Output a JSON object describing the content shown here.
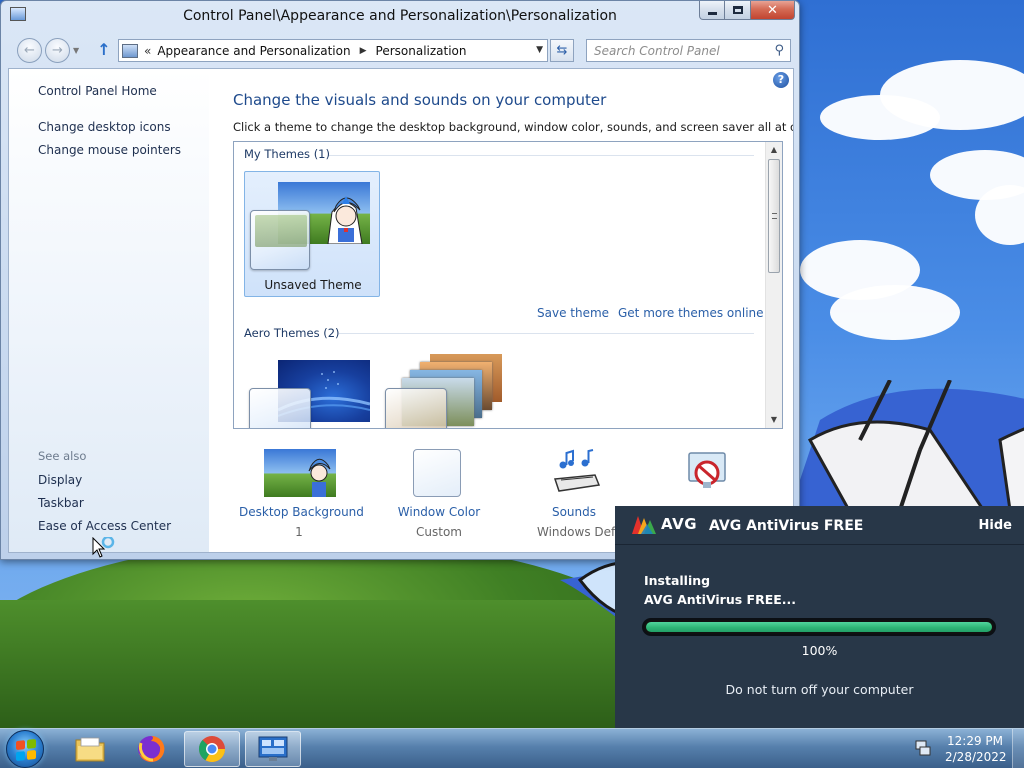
{
  "window": {
    "title": "Control Panel\\Appearance and Personalization\\Personalization",
    "breadcrumb_root": "«",
    "breadcrumb": [
      "Appearance and Personalization",
      "Personalization"
    ],
    "search_placeholder": "Search Control Panel"
  },
  "sidebar": {
    "home": "Control Panel Home",
    "tasks": [
      "Change desktop icons",
      "Change mouse pointers"
    ],
    "see_also_heading": "See also",
    "see_also": [
      "Display",
      "Taskbar",
      "Ease of Access Center"
    ]
  },
  "main": {
    "heading": "Change the visuals and sounds on your computer",
    "description": "Click a theme to change the desktop background, window color, sounds, and screen saver all at once.",
    "my_themes_header": "My Themes (1)",
    "unsaved_theme_label": "Unsaved Theme",
    "save_theme_link": "Save theme",
    "get_more_link": "Get more themes online",
    "aero_themes_header": "Aero Themes (2)"
  },
  "bottom": {
    "items": [
      {
        "label": "Desktop Background",
        "sub": "1"
      },
      {
        "label": "Window Color",
        "sub": "Custom"
      },
      {
        "label": "Sounds",
        "sub": "Windows Defau"
      }
    ]
  },
  "avg": {
    "brand": "AVG",
    "title": "AVG AntiVirus FREE",
    "hide": "Hide",
    "status": "Installing",
    "product": "AVG AntiVirus FREE...",
    "progress": 100,
    "percent": "100%",
    "warning": "Do not turn off your computer",
    "accent": "#2fb676"
  },
  "taskbar": {
    "apps": [
      "folder-icon",
      "firefox-icon",
      "chrome-icon",
      "control-panel-icon"
    ],
    "time": "12:29 PM",
    "date": "2/28/2022"
  }
}
